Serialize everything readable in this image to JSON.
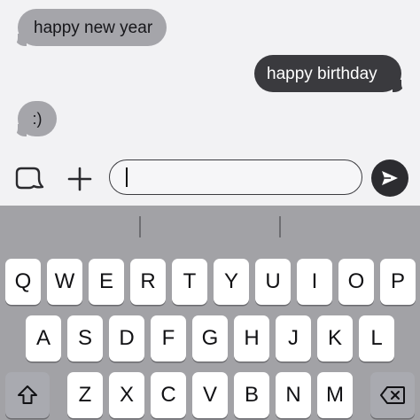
{
  "conversation": {
    "messages": [
      {
        "text": "happy new year",
        "direction": "received"
      },
      {
        "text": "happy birthday",
        "direction": "sent"
      },
      {
        "text": ":)",
        "direction": "received"
      }
    ]
  },
  "composer": {
    "input_value": "",
    "icons": [
      "sticker-icon",
      "plus-icon",
      "send-icon"
    ]
  },
  "keyboard": {
    "row1": [
      "Q",
      "W",
      "E",
      "R",
      "T",
      "Y",
      "U",
      "I",
      "O",
      "P"
    ],
    "row2": [
      "A",
      "S",
      "D",
      "F",
      "G",
      "H",
      "J",
      "K",
      "L"
    ],
    "row3": [
      "Z",
      "X",
      "C",
      "V",
      "B",
      "N",
      "M"
    ],
    "special_keys": [
      "shift-icon",
      "backspace-icon"
    ]
  },
  "colors": {
    "received_bubble": "#a5a5aa",
    "sent_bubble": "#3a3a3e",
    "keyboard_background": "#a2a2a6",
    "key_background": "#ffffff"
  }
}
